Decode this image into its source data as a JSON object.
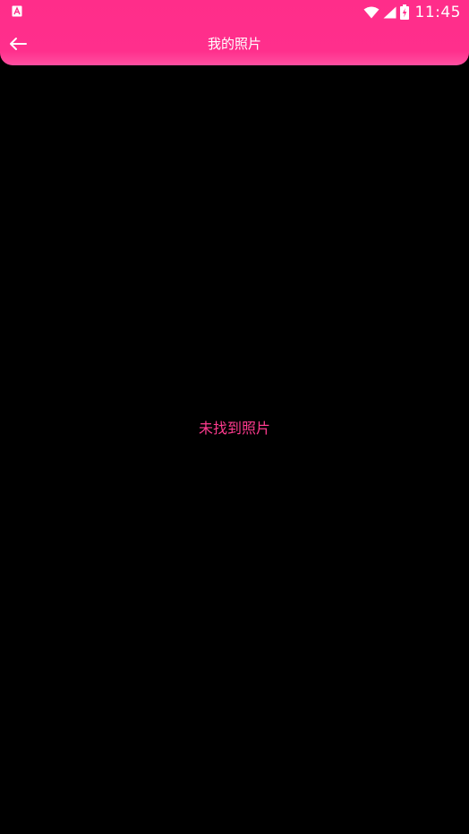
{
  "status_bar": {
    "time": "11:45",
    "left_icon": "app-notification-icon",
    "right_icons": [
      "wifi-icon",
      "signal-icon",
      "battery-charging-icon"
    ]
  },
  "toolbar": {
    "back_icon": "back-arrow-icon",
    "title": "我的照片"
  },
  "main": {
    "empty_message": "未找到照片"
  },
  "colors": {
    "accent": "#ff2d8a",
    "empty_text": "#ff3b8f",
    "background": "#000000"
  }
}
